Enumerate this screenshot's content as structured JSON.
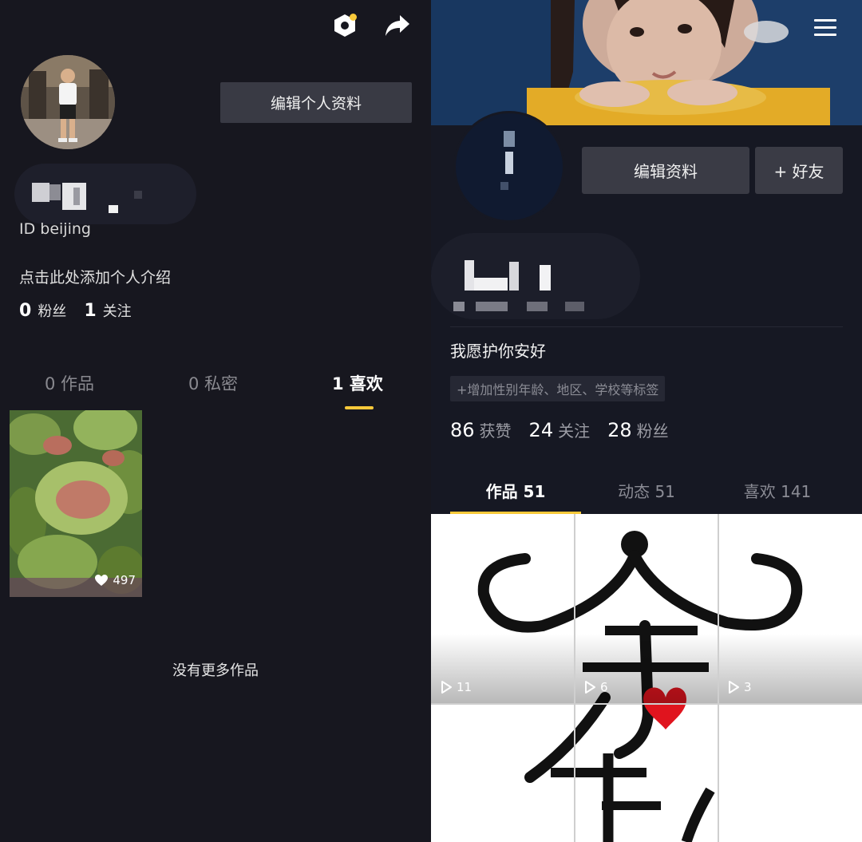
{
  "left": {
    "top_icons": [
      "hexagon-badge-icon",
      "share-arrow-icon"
    ],
    "edit_profile_label": "编辑个人资料",
    "id_line": "ID beijing",
    "bio_placeholder": "点击此处添加个人介绍",
    "stats": [
      {
        "num": "0",
        "label": "粉丝"
      },
      {
        "num": "1",
        "label": "关注"
      }
    ],
    "tabs": [
      {
        "label": "0 作品"
      },
      {
        "label": "0 私密"
      },
      {
        "label": "1 喜欢"
      }
    ],
    "active_tab": 2,
    "video": {
      "likes": "497"
    },
    "no_more_label": "没有更多作品"
  },
  "right": {
    "edit_profile_label": "编辑资料",
    "add_friend_label": "+ 好友",
    "bio": "我愿护你安好",
    "tag_hint": "+增加性别年龄、地区、学校等标签",
    "stats": [
      {
        "num": "86",
        "label": "获赞"
      },
      {
        "num": "24",
        "label": "关注"
      },
      {
        "num": "28",
        "label": "粉丝"
      }
    ],
    "tabs": [
      {
        "label": "作品 51"
      },
      {
        "label": "动态 51"
      },
      {
        "label": "喜欢 141"
      }
    ],
    "active_tab": 0,
    "videos": [
      {
        "plays": "11"
      },
      {
        "plays": "6"
      },
      {
        "plays": "3"
      }
    ]
  },
  "colors": {
    "accent": "#f8c93a",
    "bg_left": "#17171f",
    "bg_right": "#161823",
    "button_bg": "#3a3b45"
  }
}
